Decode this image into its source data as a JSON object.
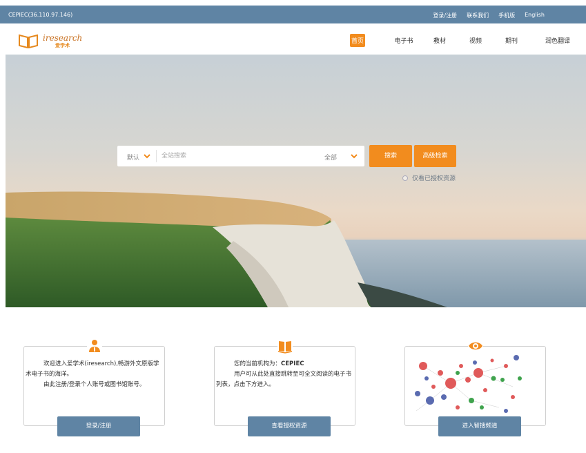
{
  "topbar": {
    "ip": "CEPIEC(36.110.97.146)",
    "links": [
      "登录/注册",
      "联系我们",
      "手机版",
      "English"
    ]
  },
  "logo": {
    "name": "iresearch",
    "sub": "爱学术"
  },
  "nav": [
    {
      "label": "首页",
      "active": true
    },
    {
      "label": "电子书"
    },
    {
      "label": "教材"
    },
    {
      "label": "视频"
    },
    {
      "label": "期刊"
    },
    {
      "label": "润色翻译"
    }
  ],
  "search": {
    "scope": "默认",
    "placeholder": "全站搜索",
    "category": "全部",
    "search_button": "搜索",
    "advanced_button": "高级检索",
    "authorized_only": "仅看已授权资源"
  },
  "cards": [
    {
      "icon": "user-icon",
      "line1": "欢迎进入爱学术(iresearch),畅游外文原版学术电子书的海洋。",
      "line2": "由此注册/登录个人账号或图书馆账号。",
      "button": "登录/注册"
    },
    {
      "icon": "book-icon",
      "org_prefix": "您的当前机构为：",
      "org": "CEPIEC",
      "line2": "用户可从此处直接跳转至可全文阅读的电子书列表，点击下方进入。",
      "button": "查看授权资源"
    },
    {
      "icon": "eye-icon",
      "button": "进入智搜频道"
    }
  ],
  "colors": {
    "accent": "#f28c1e",
    "primary": "#5f84a4"
  }
}
